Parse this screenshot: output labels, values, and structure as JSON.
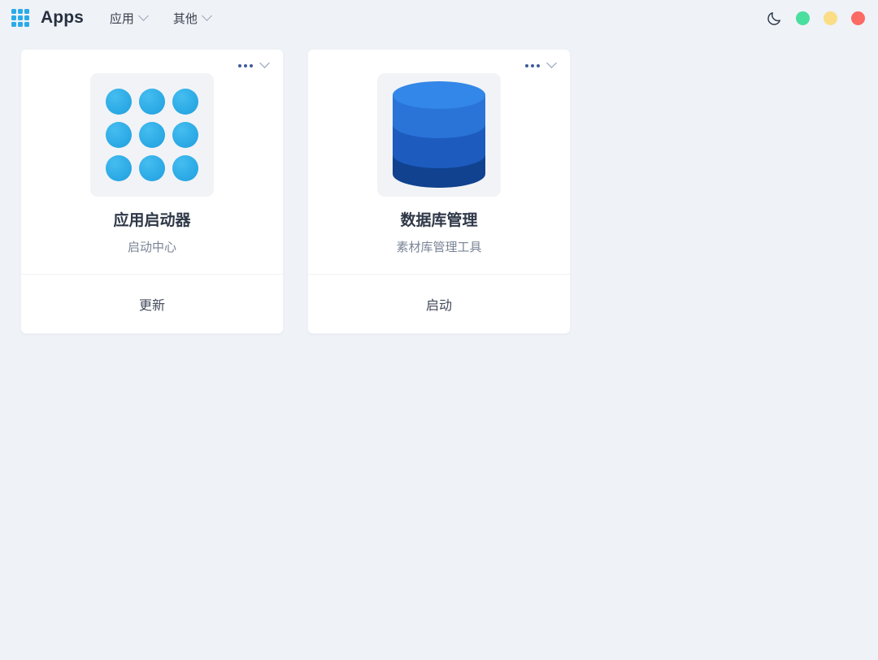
{
  "header": {
    "grid_icon": "apps-grid-icon",
    "title": "Apps",
    "nav": [
      {
        "label": "应用",
        "icon": "chevron-down-icon"
      },
      {
        "label": "其他",
        "icon": "chevron-down-icon"
      }
    ],
    "window_controls": {
      "theme_toggle_icon": "moon-icon",
      "minimize_color": "#4ade9f",
      "maximize_color": "#fbdd86",
      "close_color": "#fb6a63"
    }
  },
  "cards": [
    {
      "name": "应用启动器",
      "description": "启动中心",
      "action_label": "更新",
      "icon": "app-launcher-grid-icon",
      "more_icon": "ellipsis-icon",
      "expand_icon": "chevron-down-icon",
      "accent": "#29a8e4"
    },
    {
      "name": "数据库管理",
      "description": "素材库管理工具",
      "action_label": "启动",
      "icon": "database-cylinder-icon",
      "more_icon": "ellipsis-icon",
      "expand_icon": "chevron-down-icon",
      "accent": "#1e5fc0"
    }
  ],
  "theme": {
    "page_background": "#eff2f7",
    "card_background": "#ffffff",
    "icon_tile_background": "#f2f3f6"
  }
}
